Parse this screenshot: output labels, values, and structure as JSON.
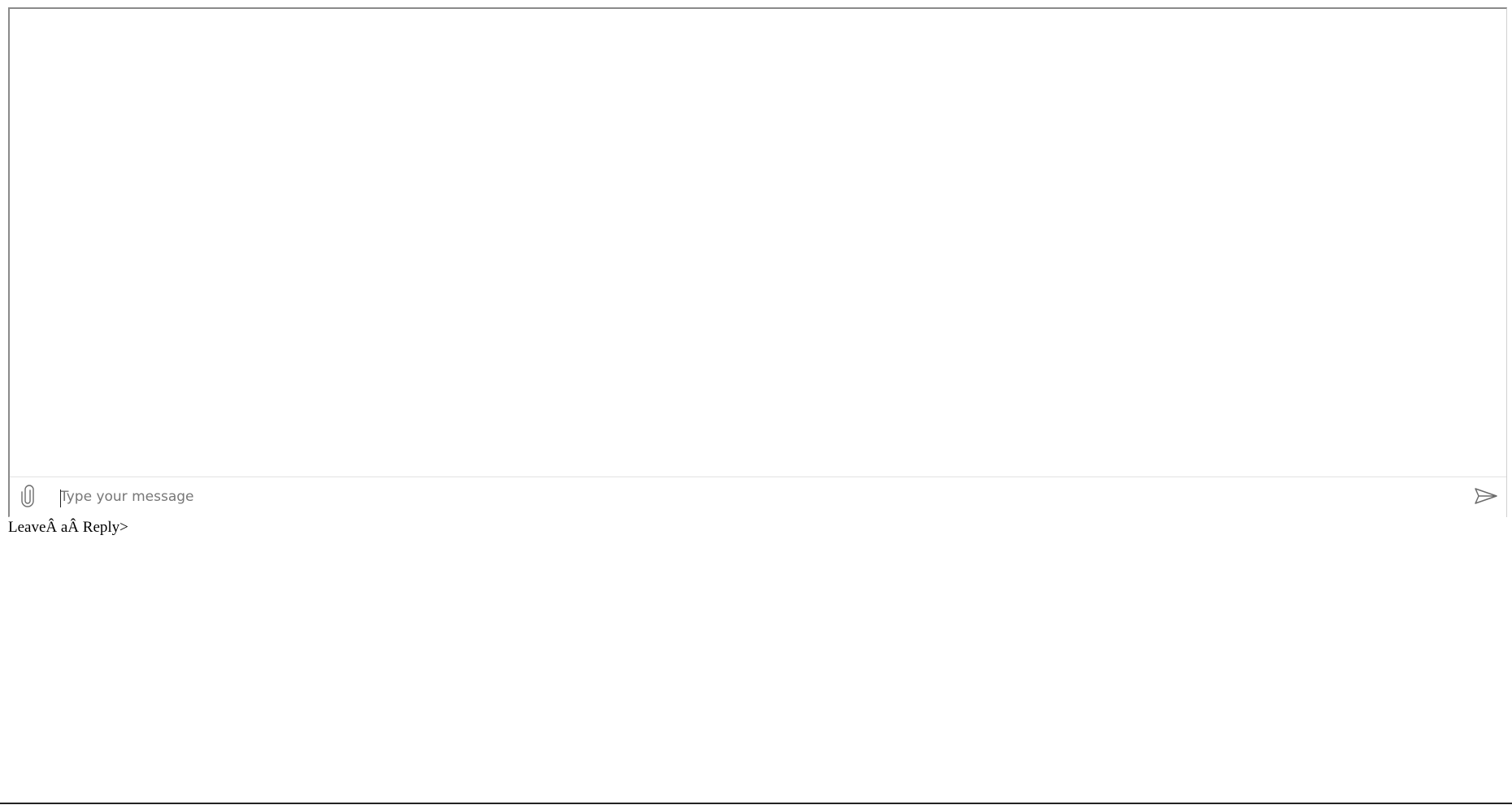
{
  "composer": {
    "placeholder": "Type your message",
    "value": "",
    "attach_icon": "paperclip-icon",
    "send_icon": "send-icon"
  },
  "footer": {
    "leave_reply": "LeaveÂ aÂ Reply>"
  },
  "colors": {
    "frame_border": "#8a8a8a",
    "icon": "#6b6b6b",
    "placeholder": "#777777"
  }
}
